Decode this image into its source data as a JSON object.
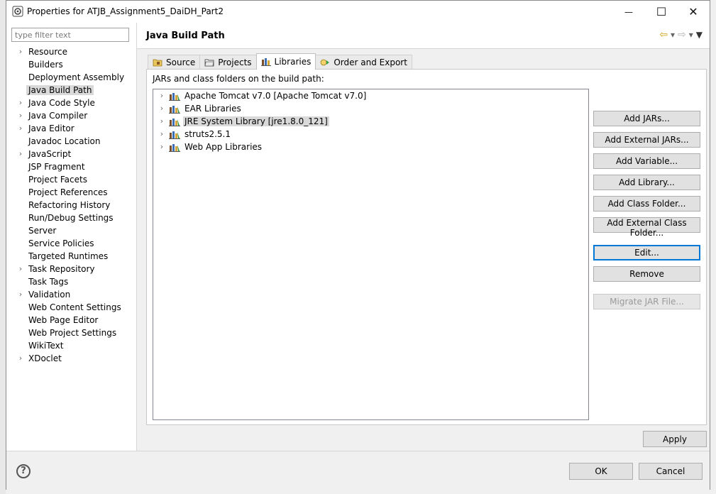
{
  "window": {
    "title": "Properties for ATJB_Assignment5_DaiDH_Part2",
    "minimize_glyph": "—",
    "maximize_glyph": "☐",
    "close_glyph": "✕"
  },
  "filter": {
    "placeholder": "type filter text",
    "value": ""
  },
  "tree": {
    "items": [
      {
        "label": "Resource",
        "expandable": true
      },
      {
        "label": "Builders",
        "expandable": false
      },
      {
        "label": "Deployment Assembly",
        "expandable": false
      },
      {
        "label": "Java Build Path",
        "expandable": false,
        "selected": true
      },
      {
        "label": "Java Code Style",
        "expandable": true
      },
      {
        "label": "Java Compiler",
        "expandable": true
      },
      {
        "label": "Java Editor",
        "expandable": true
      },
      {
        "label": "Javadoc Location",
        "expandable": false
      },
      {
        "label": "JavaScript",
        "expandable": true
      },
      {
        "label": "JSP Fragment",
        "expandable": false
      },
      {
        "label": "Project Facets",
        "expandable": false
      },
      {
        "label": "Project References",
        "expandable": false
      },
      {
        "label": "Refactoring History",
        "expandable": false
      },
      {
        "label": "Run/Debug Settings",
        "expandable": false
      },
      {
        "label": "Server",
        "expandable": false
      },
      {
        "label": "Service Policies",
        "expandable": false
      },
      {
        "label": "Targeted Runtimes",
        "expandable": false
      },
      {
        "label": "Task Repository",
        "expandable": true
      },
      {
        "label": "Task Tags",
        "expandable": false
      },
      {
        "label": "Validation",
        "expandable": true
      },
      {
        "label": "Web Content Settings",
        "expandable": false
      },
      {
        "label": "Web Page Editor",
        "expandable": false
      },
      {
        "label": "Web Project Settings",
        "expandable": false
      },
      {
        "label": "WikiText",
        "expandable": false
      },
      {
        "label": "XDoclet",
        "expandable": true
      }
    ]
  },
  "page": {
    "title": "Java Build Path",
    "tabs": [
      {
        "label": "Source",
        "icon": "source-folder-icon",
        "active": false
      },
      {
        "label": "Projects",
        "icon": "projects-folder-icon",
        "active": false
      },
      {
        "label": "Libraries",
        "icon": "libraries-icon",
        "active": true
      },
      {
        "label": "Order and Export",
        "icon": "order-export-icon",
        "active": false
      }
    ],
    "panel_label": "JARs and class folders on the build path:",
    "libraries": [
      {
        "label": "Apache Tomcat v7.0 [Apache Tomcat v7.0]",
        "selected": false
      },
      {
        "label": "EAR Libraries",
        "selected": false
      },
      {
        "label": "JRE System Library [jre1.8.0_121]",
        "selected": true
      },
      {
        "label": "struts2.5.1",
        "selected": false
      },
      {
        "label": "Web App Libraries",
        "selected": false
      }
    ],
    "buttons": {
      "add_jars": "Add JARs...",
      "add_external_jars": "Add External JARs...",
      "add_variable": "Add Variable...",
      "add_library": "Add Library...",
      "add_class_folder": "Add Class Folder...",
      "add_external_class_folder": "Add External Class Folder...",
      "edit": "Edit...",
      "remove": "Remove",
      "migrate_jar": "Migrate JAR File..."
    },
    "apply": "Apply"
  },
  "dialog": {
    "help": "?",
    "ok": "OK",
    "cancel": "Cancel"
  },
  "colors": {
    "selection": "#d9d9d9",
    "focus_border": "#0078d7",
    "back_arrow": "#d5a21e"
  }
}
